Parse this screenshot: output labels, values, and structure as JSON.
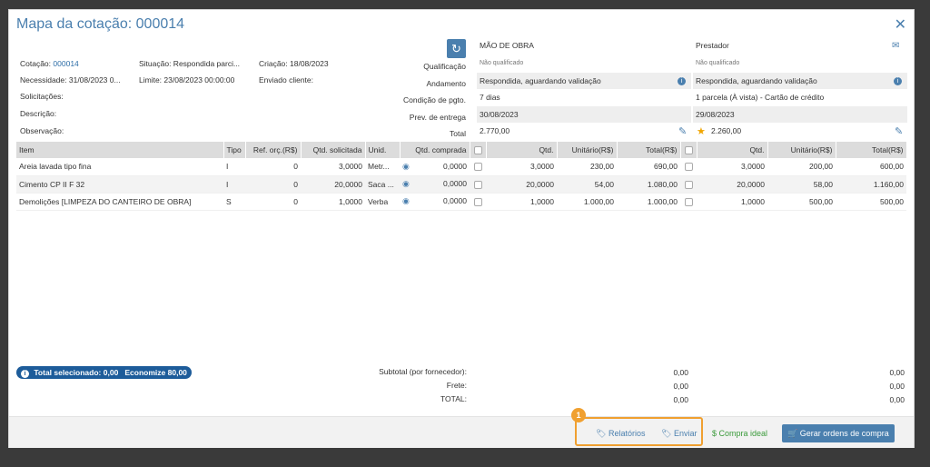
{
  "title": "Mapa da cotação: 000014",
  "info": {
    "cotacao_label": "Cotação:",
    "cotacao_value": "000014",
    "situacao": "Situação: Respondida parci...",
    "criacao": "Criação: 18/08/2023",
    "necessidade": "Necessidade: 31/08/2023 0...",
    "limite": "Limite: 23/08/2023 00:00:00",
    "enviado": "Enviado cliente:",
    "solicitacoes": "Solicitações:",
    "descricao": "Descrição:",
    "observacao": "Observação:"
  },
  "row_labels": [
    "Qualificação",
    "Andamento",
    "Condição de pgto.",
    "Prev. de entrega",
    "Total"
  ],
  "suppliers": [
    {
      "name": "MÃO DE OBRA",
      "qualificacao": "Não qualificado",
      "andamento": "Respondida, aguardando validação",
      "condicao": "7 dias",
      "entrega": "30/08/2023",
      "total": "2.770,00"
    },
    {
      "name": "Prestador",
      "qualificacao": "Não qualificado",
      "andamento": "Respondida, aguardando validação",
      "condicao": "1 parcela (À vista) - Cartão de crédito",
      "entrega": "29/08/2023",
      "total": "2.260,00"
    }
  ],
  "table": {
    "headers": [
      "Item",
      "Tipo",
      "Ref. orç.(R$)",
      "Qtd. solicitada",
      "Unid.",
      "Qtd. comprada",
      "",
      "Qtd.",
      "Unitário(R$)",
      "Total(R$)",
      "",
      "Qtd.",
      "Unitário(R$)",
      "Total(R$)"
    ],
    "rows": [
      {
        "item": "Areia lavada tipo fina",
        "tipo": "I",
        "ref": "0",
        "qtd_sol": "3,0000",
        "unid": "Metr...",
        "qtd_comp": "0,0000",
        "s1_qtd": "3,0000",
        "s1_unit": "230,00",
        "s1_total": "690,00",
        "s2_qtd": "3,0000",
        "s2_unit": "200,00",
        "s2_total": "600,00"
      },
      {
        "item": "Cimento CP II F 32",
        "tipo": "I",
        "ref": "0",
        "qtd_sol": "20,0000",
        "unid": "Saca ...",
        "qtd_comp": "0,0000",
        "s1_qtd": "20,0000",
        "s1_unit": "54,00",
        "s1_total": "1.080,00",
        "s2_qtd": "20,0000",
        "s2_unit": "58,00",
        "s2_total": "1.160,00"
      },
      {
        "item": "Demolições [LIMPEZA DO CANTEIRO DE OBRA]",
        "tipo": "S",
        "ref": "0",
        "qtd_sol": "1,0000",
        "unid": "Verba",
        "qtd_comp": "0,0000",
        "s1_qtd": "1,0000",
        "s1_unit": "1.000,00",
        "s1_total": "1.000,00",
        "s2_qtd": "1,0000",
        "s2_unit": "500,00",
        "s2_total": "500,00"
      }
    ]
  },
  "badge": {
    "icon": "i",
    "total": "Total selecionado:",
    "total_value": "0,00",
    "economize": "Economize 80,00"
  },
  "summary": {
    "labels": [
      "Subtotal (por fornecedor):",
      "Frete:",
      "TOTAL:"
    ],
    "s1": [
      "0,00",
      "0,00",
      "0,00"
    ],
    "s2": [
      "0,00",
      "0,00",
      "0,00"
    ]
  },
  "footer": {
    "relatorios": "Relatórios",
    "enviar": "Enviar",
    "compra_ideal": "Compra ideal",
    "gerar": "Gerar ordens de compra"
  },
  "callout_number": "1",
  "icons": {
    "close": "close-icon",
    "refresh": "refresh-icon",
    "mail": "mail-icon",
    "pencil": "pencil-icon",
    "star": "star-icon",
    "eye": "eye-icon"
  }
}
